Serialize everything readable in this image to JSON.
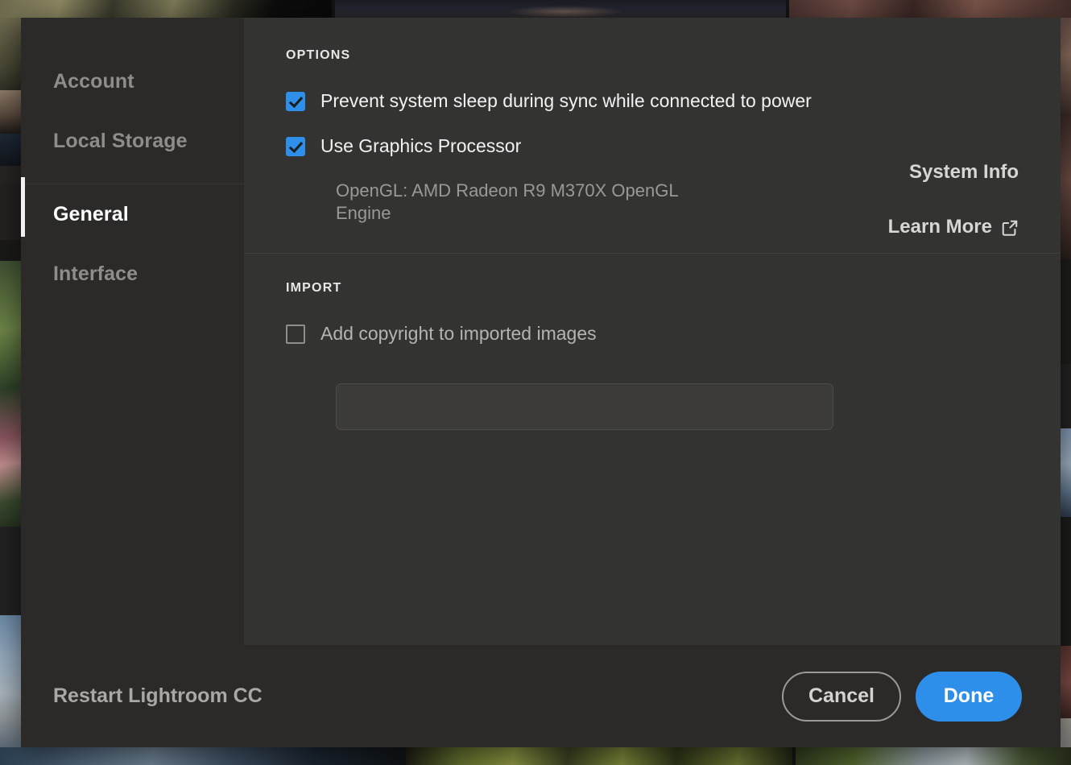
{
  "dialog": {
    "sidebar": {
      "items": [
        {
          "label": "Account",
          "selected": false
        },
        {
          "label": "Local Storage",
          "selected": false
        },
        {
          "label": "General",
          "selected": true
        },
        {
          "label": "Interface",
          "selected": false
        }
      ]
    },
    "options_section": {
      "title": "OPTIONS",
      "checkbox_prevent_sleep": {
        "label": "Prevent system sleep during sync while connected to power",
        "checked": true
      },
      "checkbox_use_gpu": {
        "label": "Use Graphics Processor",
        "checked": true
      },
      "gpu_info": "OpenGL: AMD Radeon R9 M370X OpenGL Engine",
      "system_info_link": "System Info",
      "learn_more_link": "Learn More",
      "learn_more_icon": "external-link-icon"
    },
    "import_section": {
      "title": "IMPORT",
      "checkbox_add_copyright": {
        "label": "Add copyright to imported images",
        "checked": false
      },
      "copyright_field": {
        "value": "",
        "placeholder": ""
      }
    },
    "footer": {
      "restart_label": "Restart Lightroom CC",
      "cancel_label": "Cancel",
      "done_label": "Done"
    },
    "colors": {
      "accent_blue": "#2d8fea",
      "sidebar_bg": "#2b2a29",
      "content_bg": "#333332",
      "selection_bar": "#f2f2f2"
    }
  }
}
